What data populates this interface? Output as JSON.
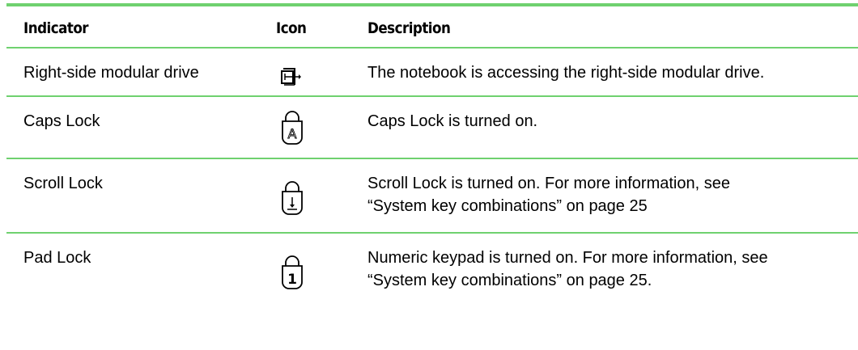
{
  "table": {
    "headers": {
      "indicator": "Indicator",
      "icon": "Icon",
      "description": "Description"
    },
    "rows": [
      {
        "indicator": "Right-side modular drive",
        "icon_name": "modular-drive-icon",
        "description": "The notebook is accessing the right-side modular drive."
      },
      {
        "indicator": "Caps Lock",
        "icon_name": "caps-lock-icon",
        "icon_glyph": "A",
        "description": "Caps Lock is turned on."
      },
      {
        "indicator": "Scroll Lock",
        "icon_name": "scroll-lock-icon",
        "description_line1": "Scroll Lock is turned on. For more information, see",
        "description_line2": "“System key combinations” on page 25"
      },
      {
        "indicator": "Pad Lock",
        "icon_name": "pad-lock-icon",
        "icon_glyph": "1",
        "description_line1": "Numeric keypad is turned on. For more information, see",
        "description_line2": "“System key combinations” on page 25."
      }
    ]
  },
  "colors": {
    "rule": "#6fd16f",
    "text": "#000000"
  }
}
